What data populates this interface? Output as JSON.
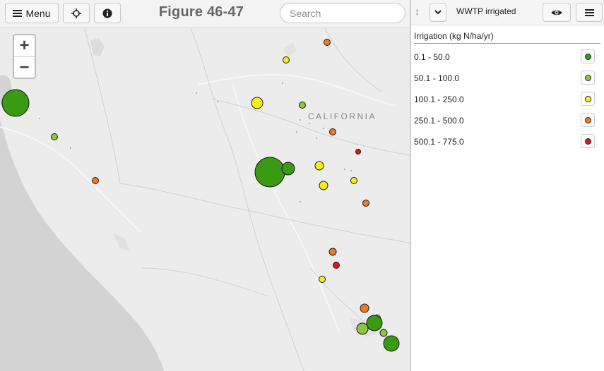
{
  "toolbar": {
    "menu_label": "Menu",
    "menu_icon": "hamburger-icon",
    "locate_icon": "crosshair-icon",
    "info_icon": "info-icon",
    "title": "Figure 46-47",
    "search_placeholder": "Search"
  },
  "map": {
    "zoom_in_label": "+",
    "zoom_out_label": "−",
    "place_label": "CALIFORNIA",
    "points": [
      {
        "cls": 4,
        "size": 1
      },
      {
        "cls": 3,
        "size": 1
      },
      {
        "cls": 1,
        "size": 5
      },
      {
        "cls": 3,
        "size": 2
      },
      {
        "cls": 2,
        "size": 1
      },
      {
        "cls": 2,
        "size": 1
      },
      {
        "cls": 4,
        "size": 1
      },
      {
        "cls": 5,
        "size": 1
      },
      {
        "cls": 1,
        "size": 5
      },
      {
        "cls": 1,
        "size": 2
      },
      {
        "cls": 3,
        "size": 1
      },
      {
        "cls": 3,
        "size": 1
      },
      {
        "cls": 3,
        "size": 1
      },
      {
        "cls": 4,
        "size": 1
      },
      {
        "cls": 4,
        "size": 1
      },
      {
        "cls": 4,
        "size": 1
      },
      {
        "cls": 5,
        "size": 1
      },
      {
        "cls": 3,
        "size": 1
      },
      {
        "cls": 4,
        "size": 1
      },
      {
        "cls": 3,
        "size": 1
      },
      {
        "cls": 1,
        "size": 2
      },
      {
        "cls": 2,
        "size": 1
      },
      {
        "cls": 2,
        "size": 1
      },
      {
        "cls": 1,
        "size": 2
      }
    ]
  },
  "panel": {
    "drag_icon": "drag-handle-icon",
    "toggle_icon": "chevron-down-icon",
    "layer_name": "WWTP irrigated",
    "visibility_icon": "eye-icon",
    "menu_icon": "hamburger-icon",
    "legend_title": "Irrigation (kg N/ha/yr)",
    "legend": [
      {
        "label": "0.1 - 50.0",
        "color": "#3a9a12"
      },
      {
        "label": "50.1 - 100.0",
        "color": "#8cc63f"
      },
      {
        "label": "100.1 - 250.0",
        "color": "#f5f01c"
      },
      {
        "label": "250.1 - 500.0",
        "color": "#f07a24"
      },
      {
        "label": "500.1 - 775.0",
        "color": "#e3141e"
      }
    ]
  }
}
